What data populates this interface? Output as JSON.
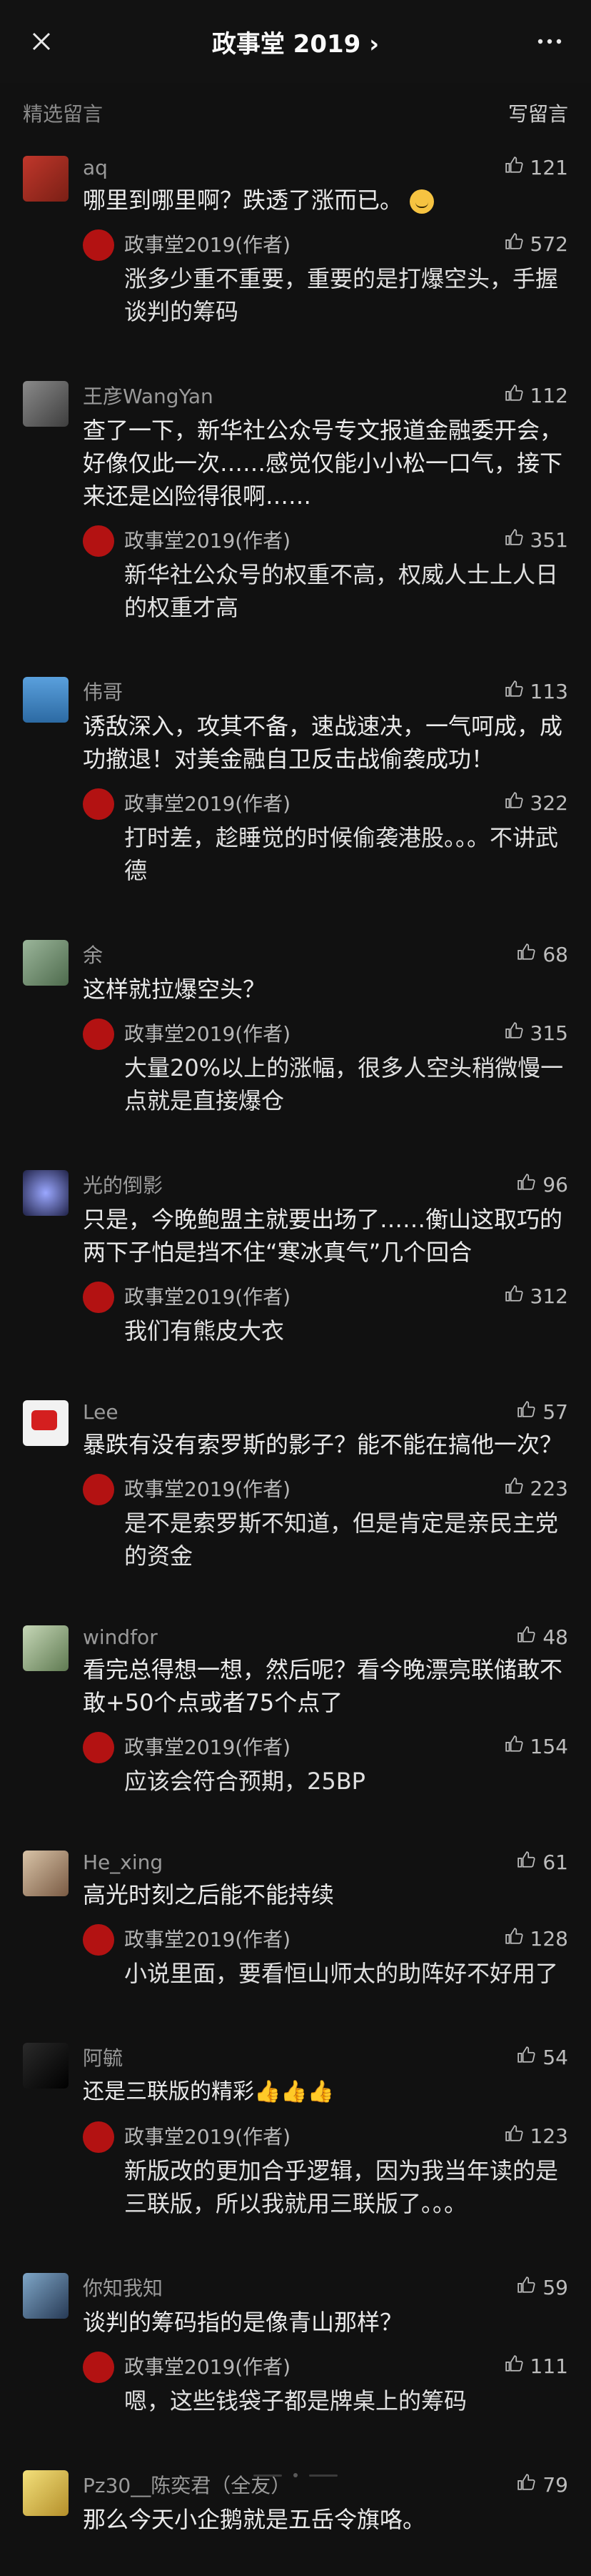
{
  "header": {
    "title": "政事堂 2019 ›"
  },
  "section": {
    "featured": "精选留言",
    "write": "写留言"
  },
  "colors": {
    "bg": "#111111",
    "badge_red": "#b31212"
  },
  "comments": [
    {
      "user": "aq",
      "likes": "121",
      "text": "哪里到哪里啊？跌透了涨而已。",
      "reply": {
        "user": "政事堂2019(作者)",
        "likes": "572",
        "text": "涨多少重不重要，重要的是打爆空头，手握谈判的筹码"
      }
    },
    {
      "user": "王彦WangYan",
      "likes": "112",
      "text": "查了一下，新华社公众号专文报道金融委开会，好像仅此一次……感觉仅能小小松一口气，接下来还是凶险得很啊……",
      "reply": {
        "user": "政事堂2019(作者)",
        "likes": "351",
        "text": "新华社公众号的权重不高，权威人士上人日的权重才高"
      }
    },
    {
      "user": "伟哥",
      "likes": "113",
      "text": "诱敌深入，攻其不备，速战速决，一气呵成，成功撤退！对美金融自卫反击战偷袭成功！",
      "reply": {
        "user": "政事堂2019(作者)",
        "likes": "322",
        "text": "打时差，趁睡觉的时候偷袭港股。。。不讲武德"
      }
    },
    {
      "user": "余",
      "likes": "68",
      "text": "这样就拉爆空头？",
      "reply": {
        "user": "政事堂2019(作者)",
        "likes": "315",
        "text": "大量20%以上的涨幅，很多人空头稍微慢一点就是直接爆仓"
      }
    },
    {
      "user": "光的倒影",
      "likes": "96",
      "text": "只是，今晚鲍盟主就要出场了……衡山这取巧的两下子怕是挡不住“寒冰真气”几个回合",
      "reply": {
        "user": "政事堂2019(作者)",
        "likes": "312",
        "text": "我们有熊皮大衣"
      }
    },
    {
      "user": "Lee",
      "likes": "57",
      "text": "暴跌有没有索罗斯的影子？能不能在搞他一次？",
      "reply": {
        "user": "政事堂2019(作者)",
        "likes": "223",
        "text": "是不是索罗斯不知道，但是肯定是亲民主党的资金"
      }
    },
    {
      "user": "windfor",
      "likes": "48",
      "text": "看完总得想一想，然后呢？看今晚漂亮联储敢不敢+50个点或者75个点了",
      "reply": {
        "user": "政事堂2019(作者)",
        "likes": "154",
        "text": "应该会符合预期，25BP"
      }
    },
    {
      "user": "He_xing",
      "likes": "61",
      "text": "高光时刻之后能不能持续",
      "reply": {
        "user": "政事堂2019(作者)",
        "likes": "128",
        "text": "小说里面，要看恒山师太的助阵好不好用了"
      }
    },
    {
      "user": "阿毓",
      "likes": "54",
      "text": "还是三联版的精彩👍👍👍",
      "reply": {
        "user": "政事堂2019(作者)",
        "likes": "123",
        "text": "新版改的更加合乎逻辑，因为我当年读的是三联版，所以我就用三联版了。。。"
      }
    },
    {
      "user": "你知我知",
      "likes": "59",
      "text": "谈判的筹码指的是像青山那样？",
      "reply": {
        "user": "政事堂2019(作者)",
        "likes": "111",
        "text": "嗯，这些钱袋子都是牌桌上的筹码"
      }
    },
    {
      "user": "Pz30__陈奕君（全友）",
      "likes": "79",
      "text": "那么今天小企鹅就是五岳令旗咯。",
      "reply": null
    }
  ]
}
